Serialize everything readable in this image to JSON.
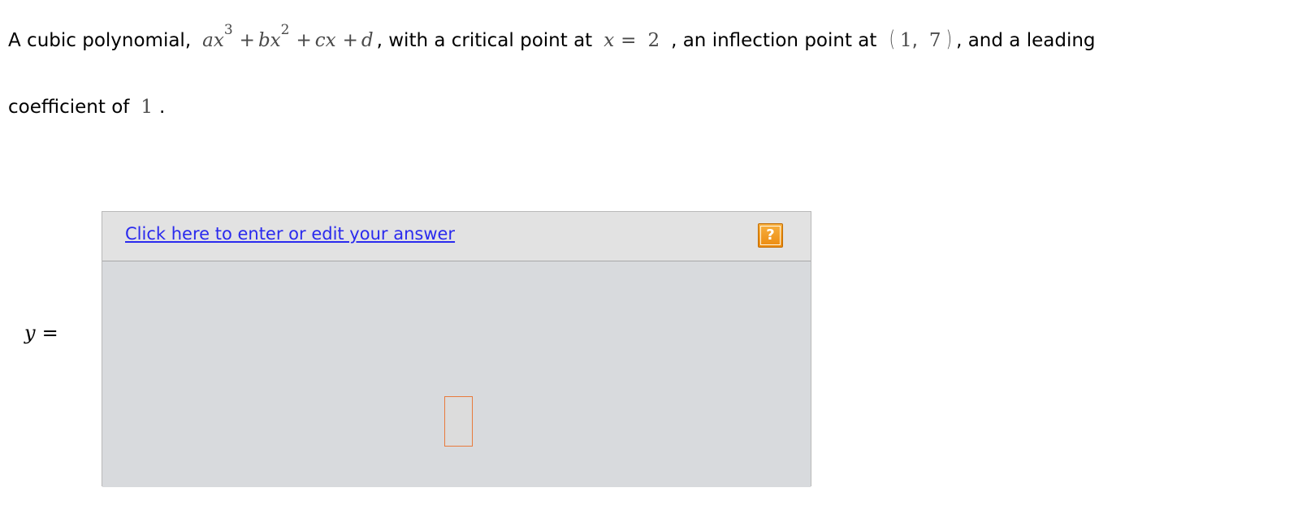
{
  "question": {
    "intro": "A cubic polynomial,",
    "poly": {
      "t1": "ax",
      "e1": "3",
      "plus1": "+",
      "t2": "bx",
      "e2": "2",
      "plus2": "+",
      "t3": "cx",
      "plus3": "+",
      "t4": "d"
    },
    "after_poly": ", with a critical point at",
    "crit_var": "x",
    "crit_eq": "=",
    "crit_val": "2",
    "after_crit": ", an inflection point at",
    "inf_open": "(",
    "inf_x": "1",
    "inf_comma": ",",
    "inf_y": "7",
    "inf_close": ")",
    "after_inf": ", and a leading",
    "line2_text": "coefficient of",
    "lead_coef": "1",
    "end_punct": "."
  },
  "answer": {
    "lhs_var": "y",
    "lhs_eq": "=",
    "edit_link": "Click here to enter or edit your answer",
    "help_icon_glyph": "?",
    "help_icon": "help-question-icon",
    "accent_color": "#ec8b10",
    "link_color": "#2a2aee"
  }
}
